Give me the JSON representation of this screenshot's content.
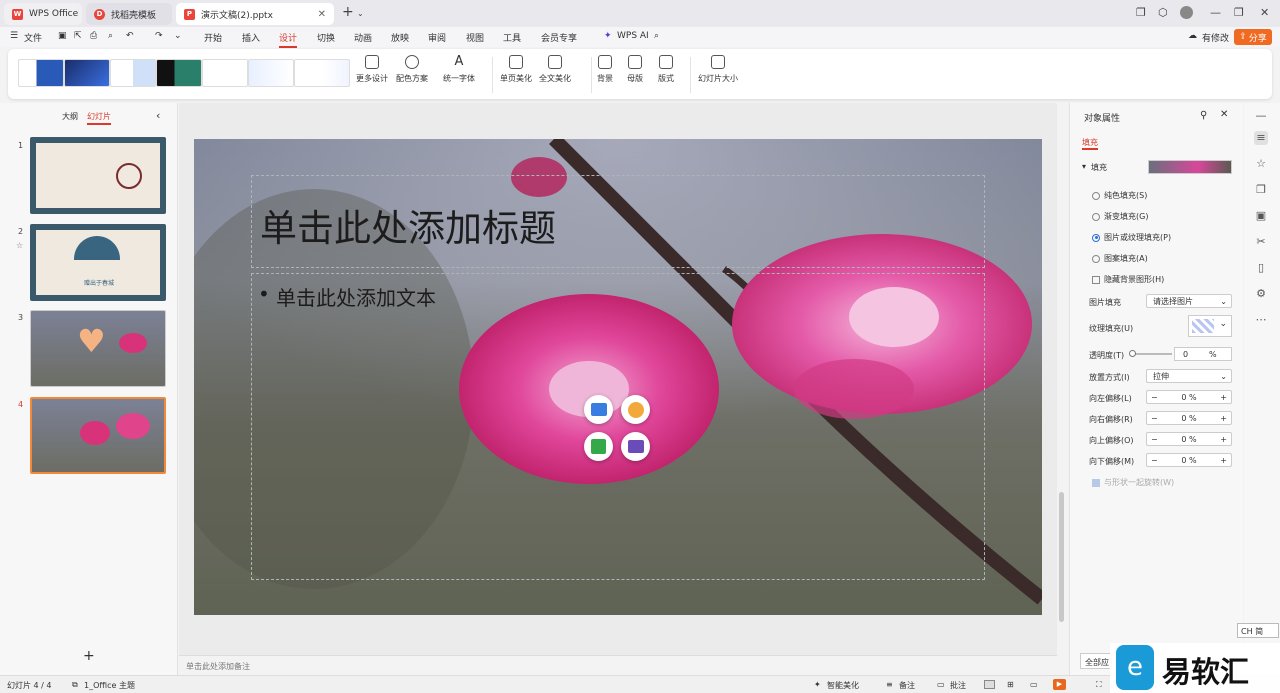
{
  "tabs": [
    {
      "label": "WPS Office"
    },
    {
      "label": "找稻壳模板"
    },
    {
      "label": "演示文稿(2).pptx"
    }
  ],
  "menu": {
    "file": "文件",
    "items": [
      "开始",
      "插入",
      "设计",
      "切换",
      "动画",
      "放映",
      "审阅",
      "视图",
      "工具",
      "会员专享"
    ],
    "wps_ai": "WPS AI",
    "edit_status": "有修改",
    "share": "分享"
  },
  "ribbon": {
    "more_design": "更多设计",
    "color_scheme": "配色方案",
    "unify_font": "统一字体",
    "single_beautify": "单页美化",
    "full_beautify": "全文美化",
    "background": "背景",
    "master": "母版",
    "layout": "版式",
    "slide_size": "幻灯片大小"
  },
  "left_panel": {
    "outline_tab": "大纲",
    "slides_tab": "幻灯片",
    "slide_numbers": [
      "1",
      "2",
      "3",
      "4"
    ],
    "slide2_caption": "赠出于春城"
  },
  "slide": {
    "title_placeholder": "单击此处添加标题",
    "body_placeholder": "单击此处添加文本"
  },
  "notes_placeholder": "单击此处添加备注",
  "right_panel": {
    "title": "对象属性",
    "tab": "填充",
    "fill_section": "填充",
    "options": [
      "纯色填充(S)",
      "渐变填充(G)",
      "图片或纹理填充(P)",
      "图案填充(A)"
    ],
    "selected_option": 2,
    "hide_bg": "隐藏背景图形(H)",
    "picture_fill_label": "图片填充",
    "picture_fill_value": "请选择图片",
    "texture_label": "纹理填充(U)",
    "transparency_label": "透明度(T)",
    "transparency_value": "0",
    "percent": "%",
    "placement_label": "放置方式(I)",
    "placement_value": "拉伸",
    "offset_left": "向左偏移(L)",
    "offset_right": "向右偏移(R)",
    "offset_up": "向上偏移(O)",
    "offset_down": "向下偏移(M)",
    "offset_value": "0",
    "rotate_with_shape": "与形状一起旋转(W)",
    "apply_all": "全部应"
  },
  "status": {
    "slide_info": "幻灯片 4 / 4",
    "theme": "1_Office 主题",
    "smart_beautify": "智能美化",
    "notes": "备注",
    "comments": "批注"
  },
  "ime": "CH 简",
  "watermark": "易软汇",
  "colors": {
    "accent": "#d93a2b",
    "share": "#f06a22",
    "blue": "#2f6fd6"
  }
}
